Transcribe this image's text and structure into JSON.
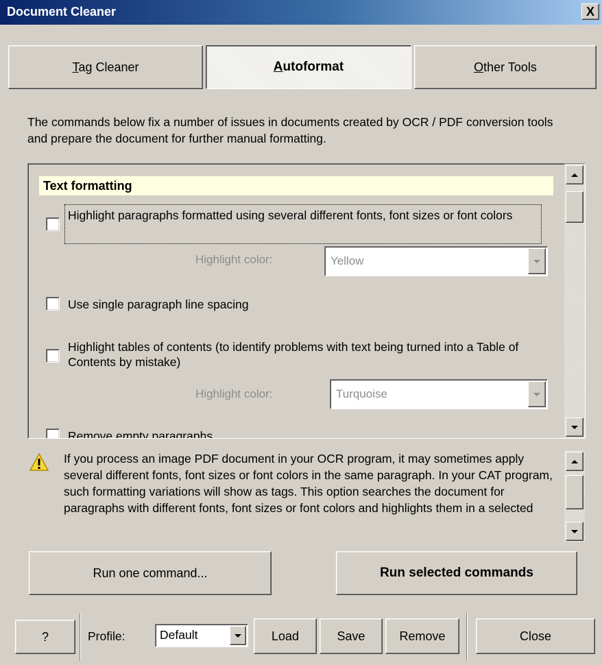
{
  "window": {
    "title": "Document Cleaner",
    "close_glyph": "X"
  },
  "tabs": [
    {
      "pre": "",
      "underline": "T",
      "post": "ag Cleaner",
      "active": false
    },
    {
      "pre": "",
      "underline": "A",
      "post": "utoformat",
      "active": true
    },
    {
      "pre": "",
      "underline": "O",
      "post": "ther Tools",
      "active": false
    }
  ],
  "intro_text": "The commands below fix a number of issues in documents created by OCR / PDF conversion tools and prepare the document for further manual formatting.",
  "commands": {
    "section_title": "Text formatting",
    "items": [
      {
        "label": "Highlight paragraphs formatted using several different fonts, font sizes or font colors",
        "checked": false
      },
      {
        "label": "Use single paragraph line spacing",
        "checked": false
      },
      {
        "label": "Highlight tables of contents (to identify problems with text being turned into a Table of Contents by mistake)",
        "checked": false
      },
      {
        "label": "Remove empty paragraphs",
        "checked": false
      }
    ],
    "highlight_label": "Highlight color:",
    "highlight_color_1": "Yellow",
    "highlight_color_2": "Turquoise"
  },
  "info": {
    "icon": "warning-icon",
    "text": "If you process an image PDF document in your OCR program, it may sometimes apply several different fonts, font sizes or font colors in the same paragraph. In your CAT program, such formatting variations will show as tags. This option searches the document for paragraphs with different fonts, font sizes or font colors and highlights them in a selected"
  },
  "actions": {
    "run_one": "Run one command...",
    "run_selected": "Run selected commands"
  },
  "footer": {
    "help": "?",
    "profile_label": "Profile:",
    "profile_value": "Default",
    "load": "Load",
    "save": "Save",
    "remove": "Remove",
    "close": "Close"
  },
  "colors": {
    "title_gradient_start": "#0a246a",
    "title_gradient_end": "#a6caf0",
    "panel": "#d4d0c8",
    "section_header_bg": "#ffffe1"
  }
}
